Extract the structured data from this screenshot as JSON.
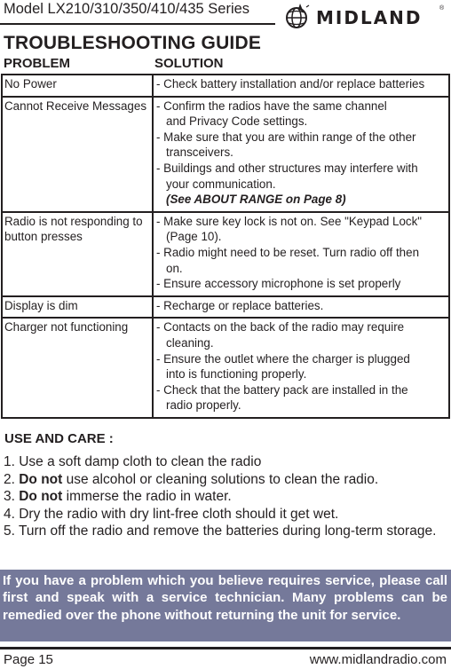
{
  "header": {
    "model": "Model LX210/310/350/410/435 Series",
    "brand": "MIDLAND",
    "registered_mark": "®",
    "logo_icon": "globe-icon"
  },
  "title": "TROUBLESHOOTING GUIDE",
  "table": {
    "headers": {
      "problem": "PROBLEM",
      "solution": "SOLUTION"
    },
    "rows": [
      {
        "problem": "No Power",
        "solutions": [
          {
            "type": "item",
            "text": "- Check battery installation and/or replace batteries"
          }
        ]
      },
      {
        "problem": "Cannot Receive Messages",
        "solutions": [
          {
            "type": "item",
            "text": "- Confirm the radios have the same channel"
          },
          {
            "type": "cont",
            "text": "and Privacy Code settings."
          },
          {
            "type": "item",
            "text": "- Make sure that you are within range of the other"
          },
          {
            "type": "cont",
            "text": "transceivers."
          },
          {
            "type": "item",
            "text": "- Buildings and other structures may interfere with"
          },
          {
            "type": "cont",
            "text": "your communication."
          },
          {
            "type": "ital",
            "text": "(See ABOUT RANGE on Page 8)"
          }
        ]
      },
      {
        "problem": "Radio is not responding to button presses",
        "solutions": [
          {
            "type": "item",
            "text": "- Make sure key lock is not on. See \"Keypad Lock\""
          },
          {
            "type": "cont",
            "text": "(Page 10)."
          },
          {
            "type": "item",
            "text": "- Radio might need to be reset.  Turn radio off then"
          },
          {
            "type": "cont",
            "text": "on."
          },
          {
            "type": "item",
            "text": "- Ensure accessory microphone is set properly"
          }
        ]
      },
      {
        "problem": "Display is dim",
        "solutions": [
          {
            "type": "item",
            "text": "- Recharge or replace batteries."
          }
        ]
      },
      {
        "problem": "Charger not functioning",
        "solutions": [
          {
            "type": "item",
            "text": "- Contacts on the back of the radio may require"
          },
          {
            "type": "cont",
            "text": "cleaning."
          },
          {
            "type": "item",
            "text": "- Ensure the outlet where the charger is plugged"
          },
          {
            "type": "cont",
            "text": "into is functioning properly."
          },
          {
            "type": "item",
            "text": "- Check that the battery pack are installed in the"
          },
          {
            "type": "cont",
            "text": "radio properly."
          }
        ]
      }
    ]
  },
  "care": {
    "title": "USE AND CARE :",
    "items": [
      {
        "num": "1. ",
        "bold": "",
        "text": "Use a soft damp cloth to clean the radio"
      },
      {
        "num": "2. ",
        "bold": "Do not",
        "text": " use alcohol or cleaning solutions to clean the radio."
      },
      {
        "num": "3. ",
        "bold": "Do not",
        "text": " immerse the radio in water."
      },
      {
        "num": "4. ",
        "bold": "",
        "text": "Dry the radio with dry lint-free cloth should it get wet."
      },
      {
        "num": "5. ",
        "bold": "",
        "text": "Turn off the radio and remove the batteries during long-term storage."
      }
    ]
  },
  "service_note": "If you have a problem which you believe requires service, please call first and speak with a service technician.  Many problems can be remedied over the phone without returning the unit for service.",
  "footer": {
    "page": "Page 15",
    "url": "www.midlandradio.com"
  },
  "colors": {
    "text": "#231f20",
    "service_box": "#75799a",
    "service_text": "#ffffff"
  }
}
